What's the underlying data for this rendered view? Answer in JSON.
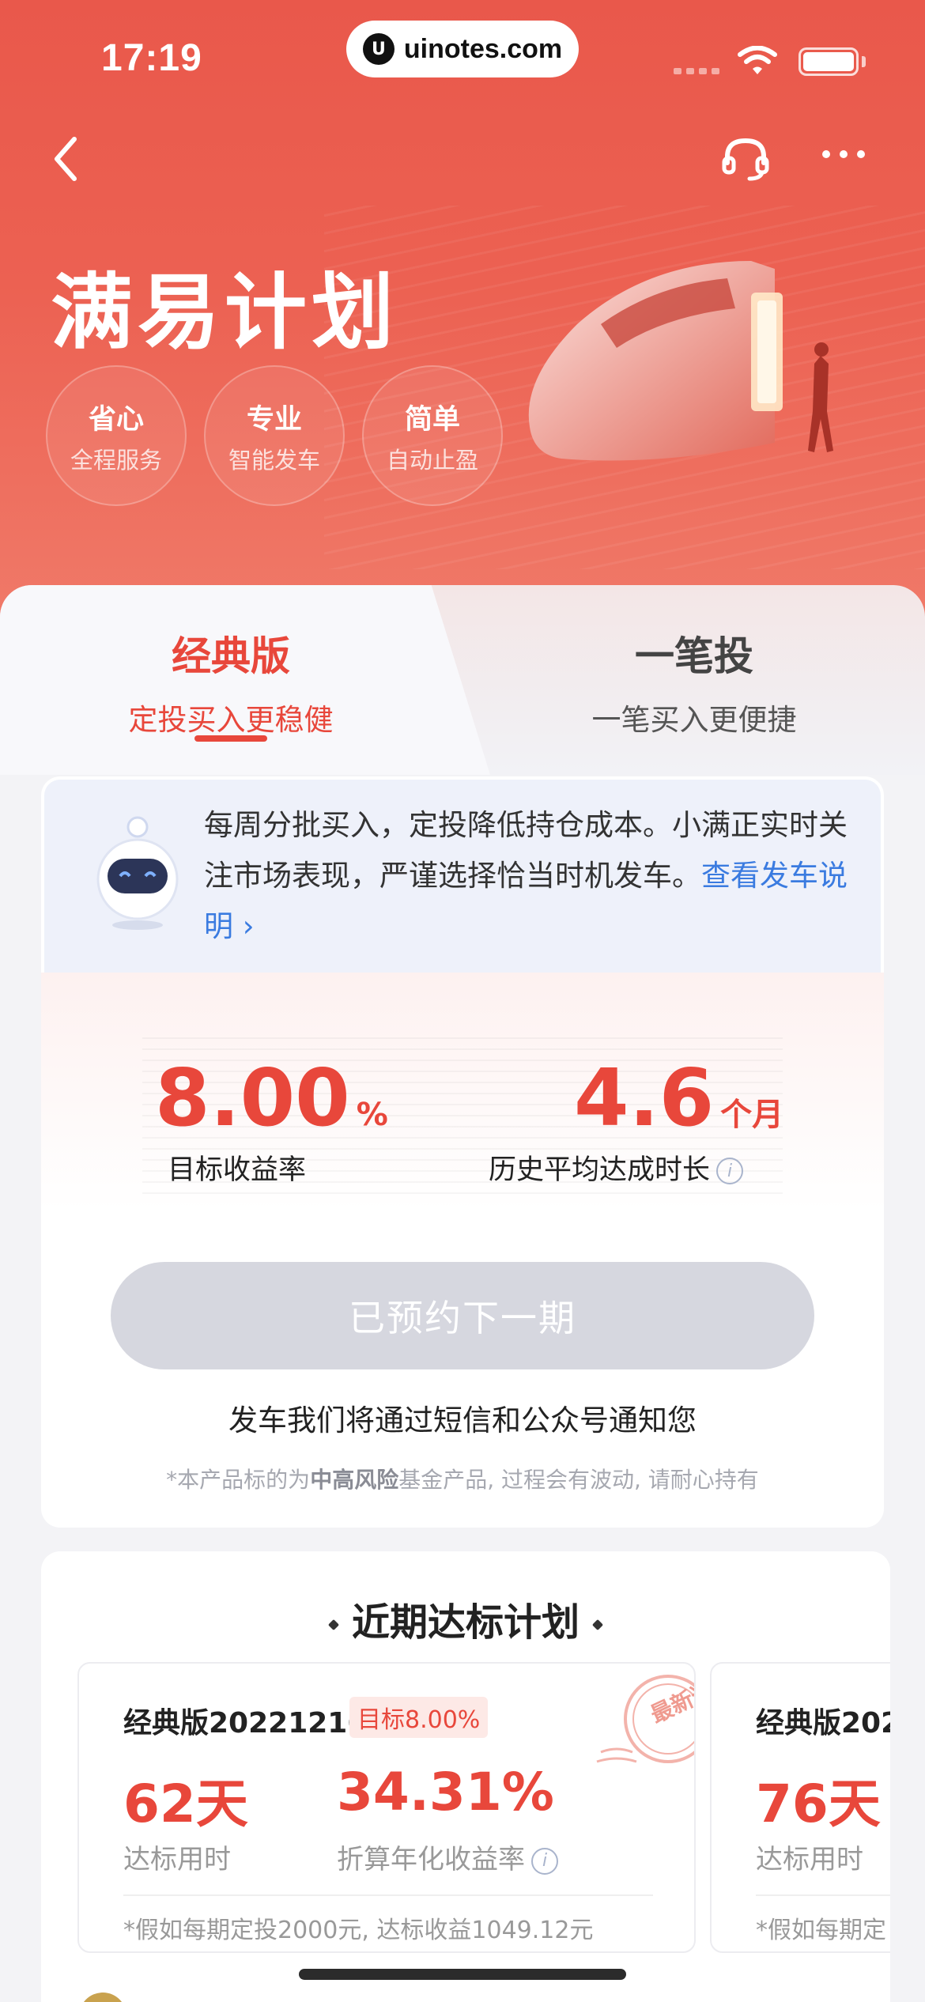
{
  "status_bar": {
    "time": "17:19",
    "url": "uinotes.com"
  },
  "hero": {
    "title": "满易计划",
    "features": [
      {
        "title": "省心",
        "subtitle": "全程服务"
      },
      {
        "title": "专业",
        "subtitle": "智能发车"
      },
      {
        "title": "简单",
        "subtitle": "自动止盈"
      }
    ]
  },
  "tabs": [
    {
      "title": "经典版",
      "subtitle": "定投买入更稳健",
      "active": true
    },
    {
      "title": "一笔投",
      "subtitle": "一笔买入更便捷",
      "active": false
    }
  ],
  "intro": {
    "text": "每周分批买入，定投降低持仓成本。小满正实时关注市场表现，严谨选择恰当时机发车。",
    "link": "查看发车说明 ›"
  },
  "metrics": {
    "target_rate_value": "8.00",
    "target_rate_unit": "%",
    "target_rate_label": "目标收益率",
    "avg_duration_value": "4.6",
    "avg_duration_unit": "个月",
    "avg_duration_label": "历史平均达成时长"
  },
  "reserve_button": "已预约下一期",
  "notify_text": "发车我们将通过短信和公众号通知您",
  "risk": {
    "prefix": "*本产品标的为",
    "level": "中高风险",
    "suffix": "基金产品, 过程会有波动, 请耐心持有"
  },
  "recent_plans": {
    "title": "近期达标计划",
    "stamp": "最新达标",
    "items": [
      {
        "name": "经典版20221216",
        "tag": "目标8.00%",
        "days": "62天",
        "days_label": "达标用时",
        "rate": "34.31%",
        "rate_label": "折算年化收益率",
        "note": "*假如每期定投2000元, 达标收益1049.12元"
      },
      {
        "name": "经典版202",
        "days": "76天",
        "days_label": "达标用时",
        "note": "*假如每期定"
      }
    ]
  },
  "colors": {
    "brand_red": "#e8473b",
    "hero_bg": "#ec6152",
    "link_blue": "#3a7be0",
    "disabled_button": "#d6d7df"
  }
}
